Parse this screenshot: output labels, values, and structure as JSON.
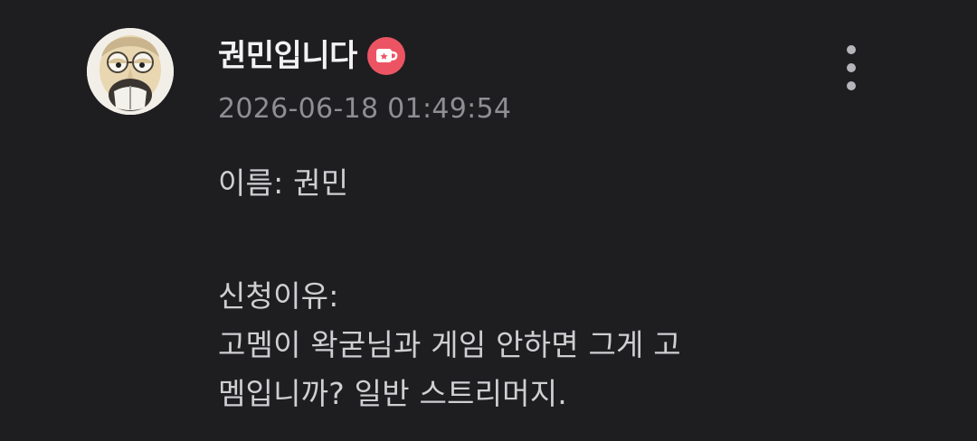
{
  "comment": {
    "author": {
      "name": "권민입니다",
      "avatar_icon": "cartoon-face-avatar",
      "badge_icon": "cup-badge-icon",
      "badge_color": "#ec5464"
    },
    "timestamp": "2026-06-18 01:49:54",
    "more_icon": "more-vertical-icon",
    "body": {
      "name_line": "이름: 권민",
      "reason_label": "신청이유:",
      "reason_line_1": "고멤이 왁굳님과 게임 안하면 그게 고",
      "reason_line_2": "멤입니까? 일반 스트리머지."
    }
  },
  "colors": {
    "background": "#1e1e21",
    "username": "#f2f2f2",
    "timestamp": "#8e8e93",
    "body_text": "#cfcfd2"
  }
}
